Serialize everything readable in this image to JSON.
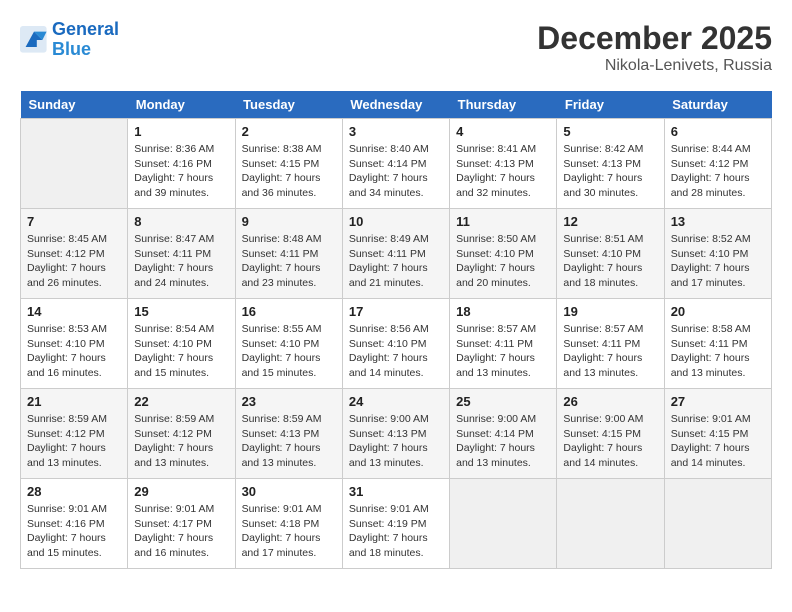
{
  "header": {
    "logo_line1": "General",
    "logo_line2": "Blue",
    "month": "December 2025",
    "location": "Nikola-Lenivets, Russia"
  },
  "days_of_week": [
    "Sunday",
    "Monday",
    "Tuesday",
    "Wednesday",
    "Thursday",
    "Friday",
    "Saturday"
  ],
  "weeks": [
    [
      {
        "day": "",
        "empty": true
      },
      {
        "day": "1",
        "sunrise": "Sunrise: 8:36 AM",
        "sunset": "Sunset: 4:16 PM",
        "daylight": "Daylight: 7 hours and 39 minutes."
      },
      {
        "day": "2",
        "sunrise": "Sunrise: 8:38 AM",
        "sunset": "Sunset: 4:15 PM",
        "daylight": "Daylight: 7 hours and 36 minutes."
      },
      {
        "day": "3",
        "sunrise": "Sunrise: 8:40 AM",
        "sunset": "Sunset: 4:14 PM",
        "daylight": "Daylight: 7 hours and 34 minutes."
      },
      {
        "day": "4",
        "sunrise": "Sunrise: 8:41 AM",
        "sunset": "Sunset: 4:13 PM",
        "daylight": "Daylight: 7 hours and 32 minutes."
      },
      {
        "day": "5",
        "sunrise": "Sunrise: 8:42 AM",
        "sunset": "Sunset: 4:13 PM",
        "daylight": "Daylight: 7 hours and 30 minutes."
      },
      {
        "day": "6",
        "sunrise": "Sunrise: 8:44 AM",
        "sunset": "Sunset: 4:12 PM",
        "daylight": "Daylight: 7 hours and 28 minutes."
      }
    ],
    [
      {
        "day": "7",
        "sunrise": "Sunrise: 8:45 AM",
        "sunset": "Sunset: 4:12 PM",
        "daylight": "Daylight: 7 hours and 26 minutes."
      },
      {
        "day": "8",
        "sunrise": "Sunrise: 8:47 AM",
        "sunset": "Sunset: 4:11 PM",
        "daylight": "Daylight: 7 hours and 24 minutes."
      },
      {
        "day": "9",
        "sunrise": "Sunrise: 8:48 AM",
        "sunset": "Sunset: 4:11 PM",
        "daylight": "Daylight: 7 hours and 23 minutes."
      },
      {
        "day": "10",
        "sunrise": "Sunrise: 8:49 AM",
        "sunset": "Sunset: 4:11 PM",
        "daylight": "Daylight: 7 hours and 21 minutes."
      },
      {
        "day": "11",
        "sunrise": "Sunrise: 8:50 AM",
        "sunset": "Sunset: 4:10 PM",
        "daylight": "Daylight: 7 hours and 20 minutes."
      },
      {
        "day": "12",
        "sunrise": "Sunrise: 8:51 AM",
        "sunset": "Sunset: 4:10 PM",
        "daylight": "Daylight: 7 hours and 18 minutes."
      },
      {
        "day": "13",
        "sunrise": "Sunrise: 8:52 AM",
        "sunset": "Sunset: 4:10 PM",
        "daylight": "Daylight: 7 hours and 17 minutes."
      }
    ],
    [
      {
        "day": "14",
        "sunrise": "Sunrise: 8:53 AM",
        "sunset": "Sunset: 4:10 PM",
        "daylight": "Daylight: 7 hours and 16 minutes."
      },
      {
        "day": "15",
        "sunrise": "Sunrise: 8:54 AM",
        "sunset": "Sunset: 4:10 PM",
        "daylight": "Daylight: 7 hours and 15 minutes."
      },
      {
        "day": "16",
        "sunrise": "Sunrise: 8:55 AM",
        "sunset": "Sunset: 4:10 PM",
        "daylight": "Daylight: 7 hours and 15 minutes."
      },
      {
        "day": "17",
        "sunrise": "Sunrise: 8:56 AM",
        "sunset": "Sunset: 4:10 PM",
        "daylight": "Daylight: 7 hours and 14 minutes."
      },
      {
        "day": "18",
        "sunrise": "Sunrise: 8:57 AM",
        "sunset": "Sunset: 4:11 PM",
        "daylight": "Daylight: 7 hours and 13 minutes."
      },
      {
        "day": "19",
        "sunrise": "Sunrise: 8:57 AM",
        "sunset": "Sunset: 4:11 PM",
        "daylight": "Daylight: 7 hours and 13 minutes."
      },
      {
        "day": "20",
        "sunrise": "Sunrise: 8:58 AM",
        "sunset": "Sunset: 4:11 PM",
        "daylight": "Daylight: 7 hours and 13 minutes."
      }
    ],
    [
      {
        "day": "21",
        "sunrise": "Sunrise: 8:59 AM",
        "sunset": "Sunset: 4:12 PM",
        "daylight": "Daylight: 7 hours and 13 minutes."
      },
      {
        "day": "22",
        "sunrise": "Sunrise: 8:59 AM",
        "sunset": "Sunset: 4:12 PM",
        "daylight": "Daylight: 7 hours and 13 minutes."
      },
      {
        "day": "23",
        "sunrise": "Sunrise: 8:59 AM",
        "sunset": "Sunset: 4:13 PM",
        "daylight": "Daylight: 7 hours and 13 minutes."
      },
      {
        "day": "24",
        "sunrise": "Sunrise: 9:00 AM",
        "sunset": "Sunset: 4:13 PM",
        "daylight": "Daylight: 7 hours and 13 minutes."
      },
      {
        "day": "25",
        "sunrise": "Sunrise: 9:00 AM",
        "sunset": "Sunset: 4:14 PM",
        "daylight": "Daylight: 7 hours and 13 minutes."
      },
      {
        "day": "26",
        "sunrise": "Sunrise: 9:00 AM",
        "sunset": "Sunset: 4:15 PM",
        "daylight": "Daylight: 7 hours and 14 minutes."
      },
      {
        "day": "27",
        "sunrise": "Sunrise: 9:01 AM",
        "sunset": "Sunset: 4:15 PM",
        "daylight": "Daylight: 7 hours and 14 minutes."
      }
    ],
    [
      {
        "day": "28",
        "sunrise": "Sunrise: 9:01 AM",
        "sunset": "Sunset: 4:16 PM",
        "daylight": "Daylight: 7 hours and 15 minutes."
      },
      {
        "day": "29",
        "sunrise": "Sunrise: 9:01 AM",
        "sunset": "Sunset: 4:17 PM",
        "daylight": "Daylight: 7 hours and 16 minutes."
      },
      {
        "day": "30",
        "sunrise": "Sunrise: 9:01 AM",
        "sunset": "Sunset: 4:18 PM",
        "daylight": "Daylight: 7 hours and 17 minutes."
      },
      {
        "day": "31",
        "sunrise": "Sunrise: 9:01 AM",
        "sunset": "Sunset: 4:19 PM",
        "daylight": "Daylight: 7 hours and 18 minutes."
      },
      {
        "day": "",
        "empty": true
      },
      {
        "day": "",
        "empty": true
      },
      {
        "day": "",
        "empty": true
      }
    ]
  ]
}
